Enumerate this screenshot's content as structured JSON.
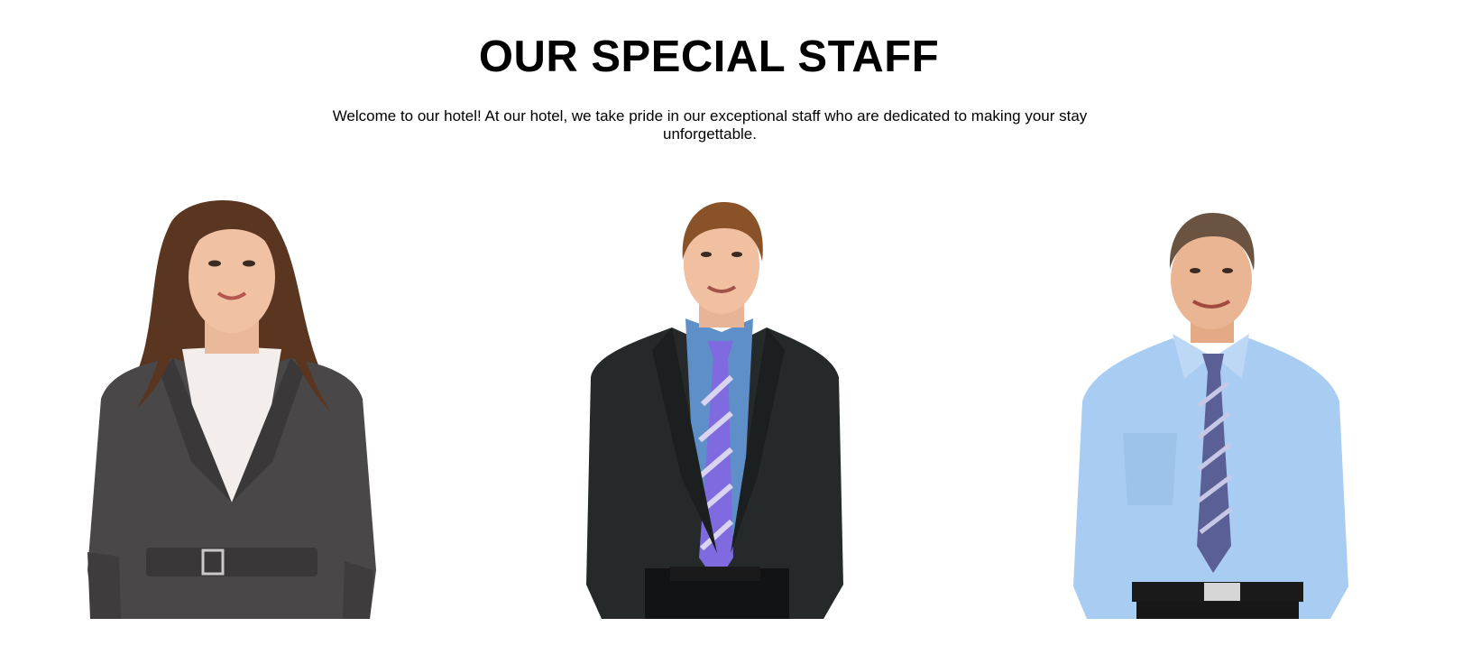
{
  "header": {
    "title": "OUR SPECIAL STAFF",
    "intro": "Welcome to our hotel! At our hotel, we take pride in our exceptional staff who are dedicated to making your stay unforgettable."
  },
  "staff": [
    {
      "photo": "staff-photo-woman-grey-blazer"
    },
    {
      "photo": "staff-photo-man-black-suit-purple-tie"
    },
    {
      "photo": "staff-photo-man-blue-shirt-striped-tie"
    }
  ],
  "colors": {
    "background": "#ffffff",
    "text": "#000000"
  }
}
